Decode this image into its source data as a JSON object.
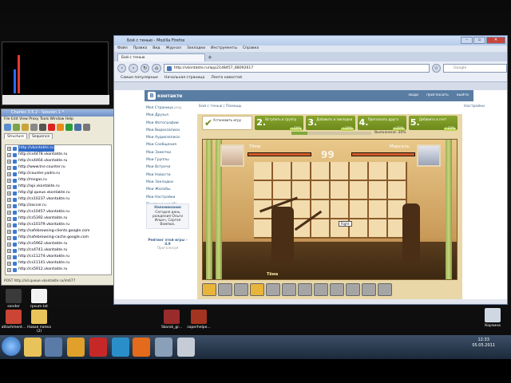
{
  "desktop": {
    "icons": [
      {
        "label": "sender"
      },
      {
        "label": "rpsum.txt"
      },
      {
        "label": "attachment..."
      },
      {
        "label": "Новая папка (2)"
      },
      {
        "label": "Skorok_gr..."
      },
      {
        "label": "saperhelpe..."
      },
      {
        "label": "Корзина"
      }
    ]
  },
  "charles": {
    "title": "Charles 3.5.2 - Session 1 *",
    "menu": [
      "File",
      "Edit",
      "View",
      "Proxy",
      "Tools",
      "Window",
      "Help"
    ],
    "tabs": [
      "Structure",
      "Sequence"
    ],
    "tree": [
      "http://vkontakte.ru",
      "http://cs4478.vkontakte.ru",
      "http://cs4464.vkontakte.ru",
      "http://www.tns-counter.ru",
      "http://counter.yadro.ru",
      "http://mngas.ru",
      "http://api.vkontakte.ru",
      "http://gl.queue.vkontakte.ru",
      "http://cs10237.vkontakte.ru",
      "http://zoccer.ru",
      "http://cs10457.vkontakte.ru",
      "http://cs5392.vkontakte.ru",
      "http://cs10379.vkontakte.ru",
      "http://safebrowsing-clients.google.com",
      "http://safebrowsing-cache.google.com",
      "http://cs5962.vkontakte.ru",
      "http://cs4741.vkontakte.ru",
      "http://cs11274.vkontakte.ru",
      "http://cs11141.vkontakte.ru",
      "http://cs5912.vkontakte.ru"
    ],
    "status": "POST http://all.queue.vkontakte.ru/im677"
  },
  "firefox": {
    "title": "Бой с тенью - Mozilla Firefox",
    "menu": [
      "Файл",
      "Правка",
      "Вид",
      "Журнал",
      "Закладки",
      "Инструменты",
      "Справка"
    ],
    "tab": "Бой с тенью",
    "url": "http://vkontakte.ru/app2148457_88092617",
    "search_placeholder": "Google",
    "bookmarks": [
      "Самые популярные",
      "Начальная страница",
      "Лента новостей"
    ]
  },
  "vk": {
    "logo": "контакте",
    "header_links": [
      "люди",
      "пригласить",
      "выйти"
    ],
    "sidebar": [
      "Моя Страница",
      "Мои Друзья",
      "Мои Фотографии",
      "Мои Видеозаписи",
      "Мои Аудиозаписи",
      "Мои Сообщения",
      "Мои Заметки",
      "Мои Группы",
      "Мои Встречи",
      "Мои Новости",
      "Мои Закладки",
      "Мои Жалобы",
      "Мои Настройки",
      "Приложения (4)",
      "Объявления"
    ],
    "sidebar_extra": "ред.",
    "reminder_title": "Напоминания",
    "reminder_text": "Сегодня день рождения Ольги Ильич, Сергея Вомпюх.",
    "rating_title": "Рейтинг этой игры - 4.9",
    "rating_sub": "Проголосуй",
    "breadcrumb": "Бой с тенью | Помощь",
    "settings": "Настройки"
  },
  "game": {
    "steps": [
      {
        "n": "✔",
        "text": "Установить игру",
        "bonus": ""
      },
      {
        "n": "2.",
        "text": "Вступить в группу",
        "bonus": "+20%"
      },
      {
        "n": "3.",
        "text": "Добавить в закладки",
        "bonus": "+20%"
      },
      {
        "n": "4.",
        "text": "Пригласить друга",
        "bonus": "+20%"
      },
      {
        "n": "5.",
        "text": "Добавить в счет",
        "bonus": "+20%"
      }
    ],
    "progress_label": "Выполнено: 20%",
    "progress": 0.2,
    "player_left": "Тёма",
    "player_right": "Марсель",
    "timer": "99",
    "hint": "Right",
    "fighter_name": "Тёма"
  },
  "taskbar": {
    "time": "12:33",
    "date": "05.05.2011"
  }
}
